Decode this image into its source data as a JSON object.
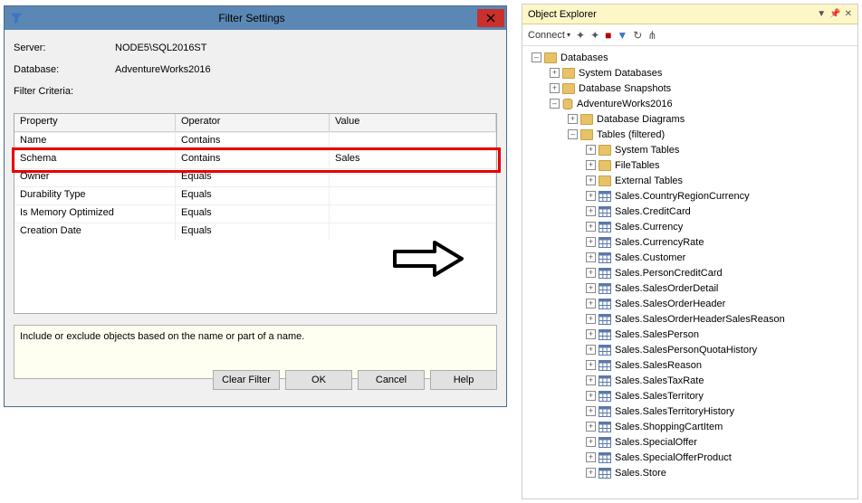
{
  "dialog": {
    "title": "Filter Settings",
    "serverLabel": "Server:",
    "serverValue": "NODE5\\SQL2016ST",
    "databaseLabel": "Database:",
    "databaseValue": "AdventureWorks2016",
    "criteriaLabel": "Filter Criteria:",
    "columns": {
      "property": "Property",
      "operator": "Operator",
      "value": "Value"
    },
    "rows": [
      {
        "property": "Name",
        "operator": "Contains",
        "value": ""
      },
      {
        "property": "Schema",
        "operator": "Contains",
        "value": "Sales"
      },
      {
        "property": "Owner",
        "operator": "Equals",
        "value": ""
      },
      {
        "property": "Durability Type",
        "operator": "Equals",
        "value": ""
      },
      {
        "property": "Is Memory Optimized",
        "operator": "Equals",
        "value": ""
      },
      {
        "property": "Creation Date",
        "operator": "Equals",
        "value": ""
      }
    ],
    "hint": "Include or exclude objects based on the name or part of a name.",
    "buttons": {
      "clear": "Clear Filter",
      "ok": "OK",
      "cancel": "Cancel",
      "help": "Help"
    }
  },
  "explorer": {
    "title": "Object Explorer",
    "connect": "Connect",
    "tree": {
      "databases": "Databases",
      "systemDatabases": "System Databases",
      "databaseSnapshots": "Database Snapshots",
      "dbName": "AdventureWorks2016",
      "databaseDiagrams": "Database Diagrams",
      "tablesFiltered": "Tables (filtered)",
      "systemTables": "System Tables",
      "fileTables": "FileTables",
      "externalTables": "External Tables",
      "tables": [
        "Sales.CountryRegionCurrency",
        "Sales.CreditCard",
        "Sales.Currency",
        "Sales.CurrencyRate",
        "Sales.Customer",
        "Sales.PersonCreditCard",
        "Sales.SalesOrderDetail",
        "Sales.SalesOrderHeader",
        "Sales.SalesOrderHeaderSalesReason",
        "Sales.SalesPerson",
        "Sales.SalesPersonQuotaHistory",
        "Sales.SalesReason",
        "Sales.SalesTaxRate",
        "Sales.SalesTerritory",
        "Sales.SalesTerritoryHistory",
        "Sales.ShoppingCartItem",
        "Sales.SpecialOffer",
        "Sales.SpecialOfferProduct",
        "Sales.Store"
      ]
    }
  }
}
